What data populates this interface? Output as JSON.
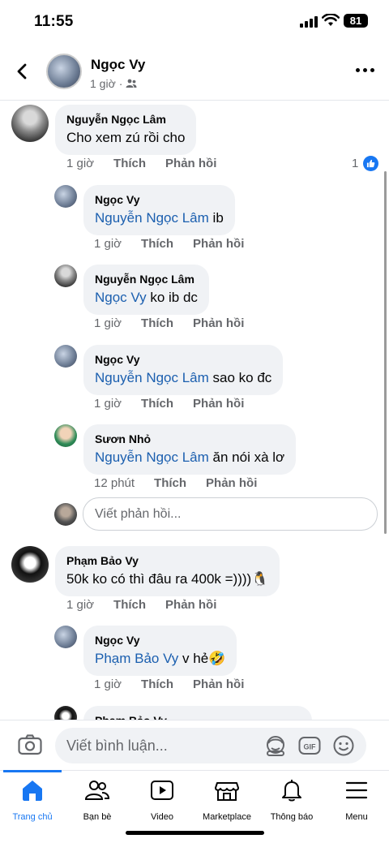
{
  "status_bar": {
    "time": "11:55",
    "battery": "81"
  },
  "header": {
    "name": "Ngọc Vy",
    "time": "1 giờ",
    "audience_icon": "friends-icon"
  },
  "comments": [
    {
      "author": "Nguyễn Ngọc Lâm",
      "mention": "",
      "text": "Cho xem zú rồi cho",
      "time": "1 giờ",
      "like": "Thích",
      "reply": "Phản hồi",
      "reaction_count": "1"
    },
    {
      "author": "Ngọc Vy",
      "mention": "Nguyễn Ngọc Lâm",
      "text": " ib",
      "time": "1 giờ",
      "like": "Thích",
      "reply": "Phản hồi"
    },
    {
      "author": "Nguyễn Ngọc Lâm",
      "mention": "Ngọc Vy",
      "text": " ko ib dc",
      "time": "1 giờ",
      "like": "Thích",
      "reply": "Phản hồi"
    },
    {
      "author": "Ngọc Vy",
      "mention": "Nguyễn Ngọc Lâm",
      "text": " sao ko đc",
      "time": "1 giờ",
      "like": "Thích",
      "reply": "Phản hồi"
    },
    {
      "author": "Sươn Nhỏ",
      "mention": "Nguyễn Ngọc Lâm",
      "text": " ăn nói xà lơ",
      "time": "12 phút",
      "like": "Thích",
      "reply": "Phản hồi"
    },
    {
      "author": "Phạm Bảo Vy",
      "mention": "",
      "text": "50k ko có thì đâu ra 400k =))))",
      "emoji": "🐧",
      "time": "1 giờ",
      "like": "Thích",
      "reply": "Phản hồi"
    },
    {
      "author": "Ngọc Vy",
      "mention": "Phạm Bảo Vy",
      "text": " v hẻ",
      "emoji": "🤣",
      "time": "1 giờ",
      "like": "Thích",
      "reply": "Phản hồi"
    },
    {
      "author": "Phạm Bảo Vy"
    }
  ],
  "reply_input": {
    "placeholder": "Viết phản hồi..."
  },
  "composer": {
    "placeholder": "Viết bình luận...",
    "gif_label": "GIF"
  },
  "tabs": [
    {
      "label": "Trang chủ",
      "icon": "home-icon",
      "active": true
    },
    {
      "label": "Bạn bè",
      "icon": "friends-icon"
    },
    {
      "label": "Video",
      "icon": "video-icon"
    },
    {
      "label": "Marketplace",
      "icon": "marketplace-icon"
    },
    {
      "label": "Thông báo",
      "icon": "bell-icon"
    },
    {
      "label": "Menu",
      "icon": "menu-icon"
    }
  ],
  "colors": {
    "accent": "#1877f2",
    "mention": "#1b5faf",
    "bubble": "#f0f2f5",
    "muted": "#65676b"
  }
}
